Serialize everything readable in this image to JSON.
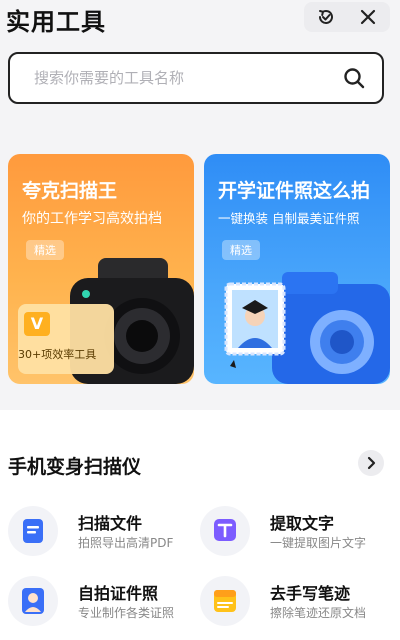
{
  "header": {
    "title": "实用工具",
    "refresh_icon": "refresh-icon",
    "close_icon": "close-icon"
  },
  "search": {
    "placeholder": "搜索你需要的工具名称",
    "icon": "search-icon"
  },
  "banners": [
    {
      "title": "夸克扫描王",
      "subtitle": "你的工作学习高效拍档",
      "tag": "精选",
      "badge": "30+项效率工具",
      "badge_mark": "V",
      "colors": {
        "top": "#ff9a3d",
        "bottom": "#ffc36a"
      }
    },
    {
      "title": "开学证件照这么拍",
      "subtitle": "一键换装 自制最美证件照",
      "tag": "精选",
      "colors": {
        "top": "#2f8df6",
        "bottom": "#58b5ff"
      }
    }
  ],
  "section": {
    "title": "手机变身扫描仪",
    "more_icon": "chevron-right-icon"
  },
  "tools": [
    {
      "title": "扫描文件",
      "subtitle": "拍照导出高清PDF",
      "icon": "document-icon"
    },
    {
      "title": "提取文字",
      "subtitle": "一键提取图片文字",
      "icon": "text-extract-icon"
    },
    {
      "title": "自拍证件照",
      "subtitle": "专业制作各类证照",
      "icon": "id-photo-icon"
    },
    {
      "title": "去手写笔迹",
      "subtitle": "擦除笔迹还原文档",
      "icon": "eraser-icon"
    }
  ]
}
